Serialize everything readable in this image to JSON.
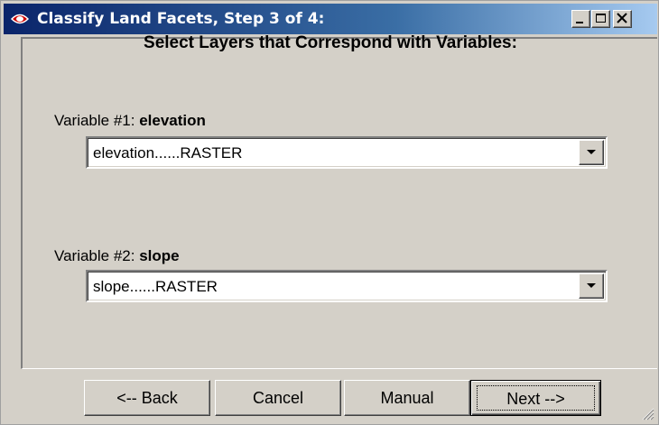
{
  "window": {
    "title": "Classify Land Facets, Step 3 of 4:"
  },
  "main": {
    "heading": "Select Layers that Correspond with Variables:",
    "variables": [
      {
        "prefix": "Variable #1: ",
        "name": "elevation",
        "selected": "elevation......RASTER"
      },
      {
        "prefix": "Variable #2: ",
        "name": "slope",
        "selected": "slope......RASTER"
      }
    ]
  },
  "buttons": {
    "back": "<-- Back",
    "cancel": "Cancel",
    "manual": "Manual",
    "next": "Next -->"
  },
  "colors": {
    "titlebar_start": "#0a246a",
    "titlebar_end": "#a6caf0",
    "face": "#d4d0c8",
    "icon_red": "#cc0000"
  },
  "icons": {
    "app": "red-eye-icon",
    "minimize": "minimize-icon",
    "maximize": "maximize-icon",
    "close": "close-icon",
    "dropdown": "dropdown-arrow-icon",
    "grip": "resize-grip-icon"
  }
}
